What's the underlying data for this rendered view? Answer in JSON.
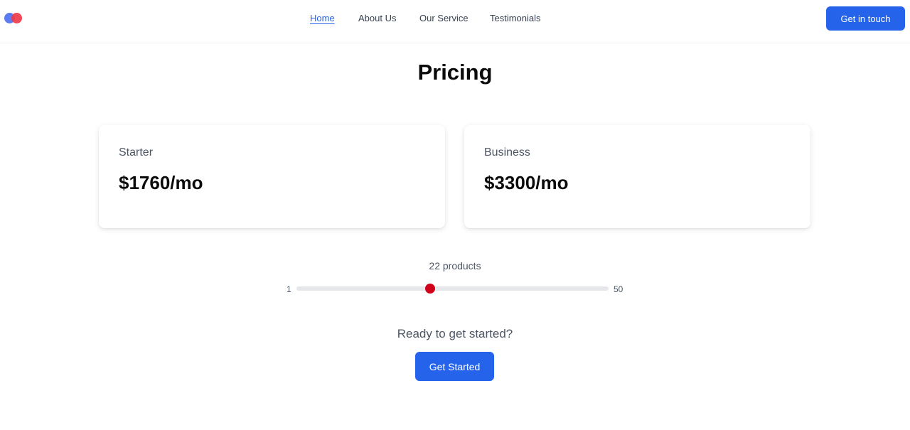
{
  "header": {
    "logo": {
      "colors": [
        "#5b7cf0",
        "#ef3b4a"
      ]
    },
    "nav": [
      {
        "label": "Home",
        "active": true
      },
      {
        "label": "About Us",
        "active": false
      },
      {
        "label": "Our Service",
        "active": false
      },
      {
        "label": "Testimonials",
        "active": false
      }
    ],
    "cta_label": "Get in touch"
  },
  "main": {
    "title": "Pricing",
    "plans": [
      {
        "name": "Starter",
        "price": "$1760/mo"
      },
      {
        "name": "Business",
        "price": "$3300/mo"
      }
    ],
    "slider": {
      "count_label": "22 products",
      "min": 1,
      "max": 50,
      "value": 22,
      "min_label": "1",
      "max_label": "50",
      "thumb_color": "#d0021b"
    },
    "ready_text": "Ready to get started?",
    "cta_label": "Get Started"
  },
  "colors": {
    "accent": "#2563eb"
  }
}
